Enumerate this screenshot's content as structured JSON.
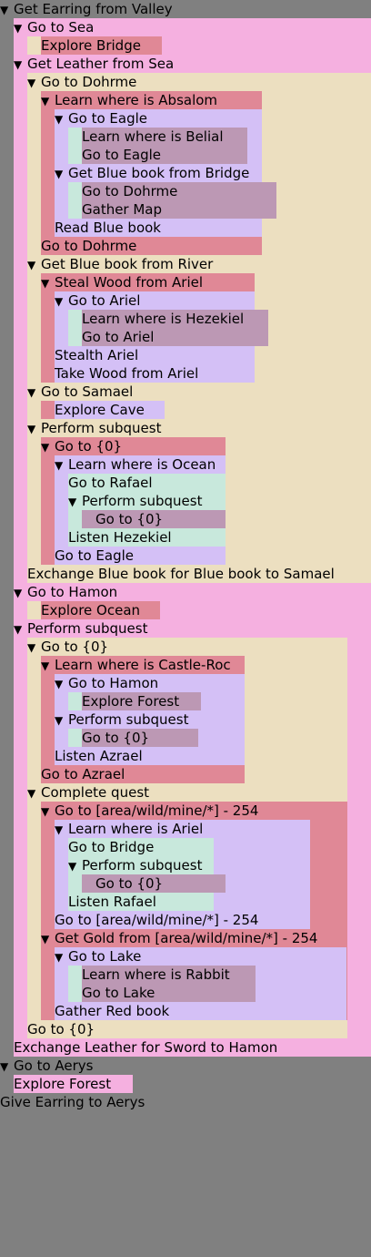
{
  "tree": {
    "label": "Get Earring from Valley",
    "children": [
      {
        "label": "Go to Sea",
        "children": [
          {
            "label": "Explore Bridge"
          }
        ]
      },
      {
        "label": "Get Leather from Sea",
        "children": [
          {
            "label": "Go to Dohrme",
            "children": [
              {
                "label": "Learn where is Absalom",
                "children": [
                  {
                    "label": "Go to Eagle",
                    "children": [
                      {
                        "label": "Learn where is Belial"
                      },
                      {
                        "label": "Go to Eagle"
                      }
                    ]
                  },
                  {
                    "label": "Get Blue book from Bridge",
                    "children": [
                      {
                        "label": "Go to Dohrme"
                      },
                      {
                        "label": "Gather Map"
                      }
                    ]
                  },
                  {
                    "label": "Read Blue book"
                  }
                ]
              },
              {
                "label": "Go to Dohrme"
              }
            ]
          },
          {
            "label": "Get Blue book from River",
            "children": [
              {
                "label": "Steal Wood from Ariel",
                "children": [
                  {
                    "label": "Go to Ariel",
                    "children": [
                      {
                        "label": "Learn where is Hezekiel"
                      },
                      {
                        "label": "Go to Ariel"
                      }
                    ]
                  },
                  {
                    "label": "Stealth Ariel"
                  },
                  {
                    "label": "Take Wood from Ariel"
                  }
                ]
              }
            ]
          },
          {
            "label": "Go to Samael",
            "children": [
              {
                "label": "Explore Cave"
              }
            ]
          },
          {
            "label": "Perform subquest",
            "children": [
              {
                "label": "Go to {0}",
                "children": [
                  {
                    "label": "Learn where is Ocean",
                    "children": [
                      {
                        "label": "Go to Rafael"
                      },
                      {
                        "label": "Perform subquest",
                        "children": [
                          {
                            "label": "Go to {0}"
                          }
                        ]
                      },
                      {
                        "label": "Listen Hezekiel"
                      }
                    ]
                  },
                  {
                    "label": "Go to Eagle"
                  }
                ]
              }
            ]
          },
          {
            "label": "Exchange Blue book for Blue book to Samael"
          }
        ]
      },
      {
        "label": "Go to Hamon",
        "children": [
          {
            "label": "Explore Ocean"
          }
        ]
      },
      {
        "label": "Perform subquest",
        "children": [
          {
            "label": "Go to {0}",
            "children": [
              {
                "label": "Learn where is Castle-Roc",
                "children": [
                  {
                    "label": "Go to Hamon",
                    "children": [
                      {
                        "label": "Explore Forest"
                      }
                    ]
                  },
                  {
                    "label": "Perform subquest",
                    "children": [
                      {
                        "label": "Go to {0}"
                      }
                    ]
                  },
                  {
                    "label": "Listen Azrael"
                  }
                ]
              },
              {
                "label": "Go to Azrael"
              }
            ]
          },
          {
            "label": "Complete quest",
            "children": [
              {
                "label": "Go to [area/wild/mine/*] - 254",
                "children": [
                  {
                    "label": "Learn where is Ariel",
                    "children": [
                      {
                        "label": "Go to Bridge"
                      },
                      {
                        "label": "Perform subquest",
                        "children": [
                          {
                            "label": "Go to {0}"
                          }
                        ]
                      },
                      {
                        "label": "Listen Rafael"
                      }
                    ]
                  },
                  {
                    "label": "Go to [area/wild/mine/*] - 254"
                  }
                ]
              },
              {
                "label": "Get Gold from [area/wild/mine/*] - 254",
                "children": [
                  {
                    "label": "Go to Lake",
                    "children": [
                      {
                        "label": "Learn where is Rabbit"
                      },
                      {
                        "label": "Go to Lake"
                      }
                    ]
                  },
                  {
                    "label": "Gather Red book"
                  }
                ]
              }
            ]
          },
          {
            "label": "Go to {0}"
          }
        ]
      },
      {
        "label": "Exchange Leather for Sword to Hamon"
      }
    ]
  },
  "tree_tail": [
    {
      "label": "Go to Aerys",
      "children": [
        {
          "label": "Explore Forest"
        }
      ]
    },
    {
      "label": "Give Earring to Aerys"
    }
  ],
  "expand_glyph": "▼",
  "palette": [
    "#808080",
    "#f5b0e0",
    "#ecdfc0",
    "#e08896",
    "#d4c0f6",
    "#c8e8dc",
    "#bc98b4"
  ]
}
